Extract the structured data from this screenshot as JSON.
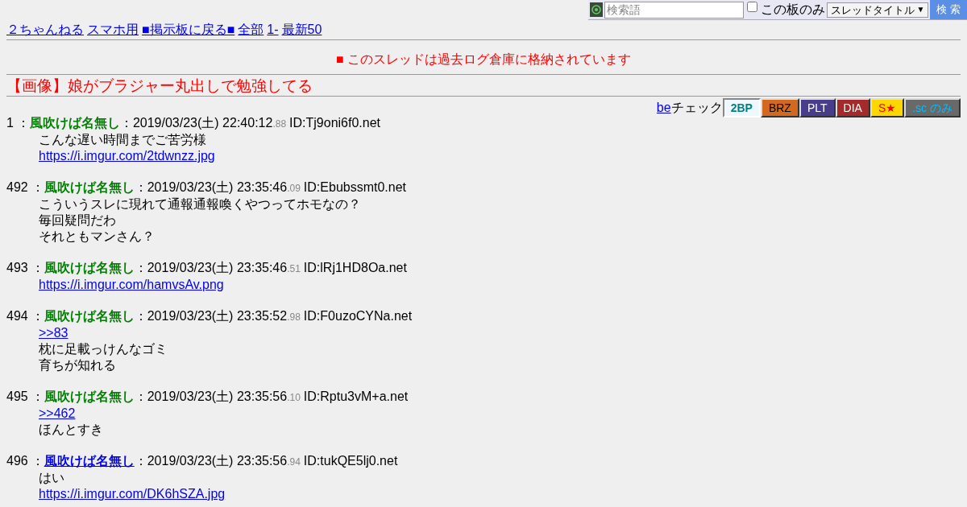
{
  "search": {
    "placeholder": "検索語",
    "board_only_label": "この板のみ",
    "board_only_checked": false,
    "scope": "スレッドタイトル",
    "arrow": "▼",
    "button": "検 索"
  },
  "nav_links": [
    "２ちゃんねる",
    "スマホ用",
    "■掲示板に戻る■",
    "全部",
    "1-",
    "最新50"
  ],
  "notice": "■ このスレッドは過去ログ倉庫に格納されています",
  "thread_title": "【画像】娘がブラジャー丸出しで勉強してる",
  "be_check": {
    "link": "be",
    "label": "チェック"
  },
  "filters": [
    {
      "label": "2BP",
      "kind": "bp",
      "selected": true
    },
    {
      "label": "BRZ",
      "kind": "brz",
      "selected": false
    },
    {
      "label": "PLT",
      "kind": "plt",
      "selected": false
    },
    {
      "label": "DIA",
      "kind": "dia",
      "selected": false
    },
    {
      "label": "S★",
      "kind": "star",
      "selected": false
    },
    {
      "label": ".sc のみ",
      "kind": "sc",
      "selected": false
    }
  ],
  "posts": [
    {
      "number": "1",
      "sep1": " ：",
      "sep2": "：",
      "name": "風吹けば名無し",
      "name_link": false,
      "date": "2019/03/23(土) 22:40:12",
      "ms": ".88",
      "id": "ID:Tj9oni6f0.net",
      "lines": [
        {
          "kind": "text",
          "text": "こんな遅い時間までご苦労様"
        },
        {
          "kind": "link",
          "text": "https://i.imgur.com/2tdwnzz.jpg"
        }
      ]
    },
    {
      "number": "492",
      "sep1": " ：",
      "sep2": "：",
      "name": "風吹けば名無し",
      "name_link": false,
      "date": "2019/03/23(土) 23:35:46",
      "ms": ".09",
      "id": "ID:Ebubssmt0.net",
      "lines": [
        {
          "kind": "text",
          "text": "こういうスレに現れて通報通報喚くやつってホモなの？"
        },
        {
          "kind": "text",
          "text": "毎回疑問だわ"
        },
        {
          "kind": "text",
          "text": "それともマンさん？"
        }
      ]
    },
    {
      "number": "493",
      "sep1": " ：",
      "sep2": "：",
      "name": "風吹けば名無し",
      "name_link": false,
      "date": "2019/03/23(土) 23:35:46",
      "ms": ".51",
      "id": "ID:lRj1HD8Oa.net",
      "lines": [
        {
          "kind": "link",
          "text": "https://i.imgur.com/hamvsAv.png"
        }
      ]
    },
    {
      "number": "494",
      "sep1": " ：",
      "sep2": "：",
      "name": "風吹けば名無し",
      "name_link": false,
      "date": "2019/03/23(土) 23:35:52",
      "ms": ".98",
      "id": "ID:F0uzoCYNa.net",
      "lines": [
        {
          "kind": "link",
          "text": ">>83"
        },
        {
          "kind": "text",
          "text": "枕に足載っけんなゴミ"
        },
        {
          "kind": "text",
          "text": "育ちが知れる"
        }
      ]
    },
    {
      "number": "495",
      "sep1": " ：",
      "sep2": "：",
      "name": "風吹けば名無し",
      "name_link": false,
      "date": "2019/03/23(土) 23:35:56",
      "ms": ".10",
      "id": "ID:Rptu3vM+a.net",
      "lines": [
        {
          "kind": "link",
          "text": ">>462"
        },
        {
          "kind": "text",
          "text": "ほんとすき"
        }
      ]
    },
    {
      "number": "496",
      "sep1": " ：",
      "sep2": "：",
      "name": "風吹けば名無し",
      "name_link": true,
      "date": "2019/03/23(土) 23:35:56",
      "ms": ".94",
      "id": "ID:tukQE5lj0.net",
      "lines": [
        {
          "kind": "text",
          "text": "はい"
        },
        {
          "kind": "link",
          "text": "https://i.imgur.com/DK6hSZA.jpg"
        }
      ]
    }
  ]
}
